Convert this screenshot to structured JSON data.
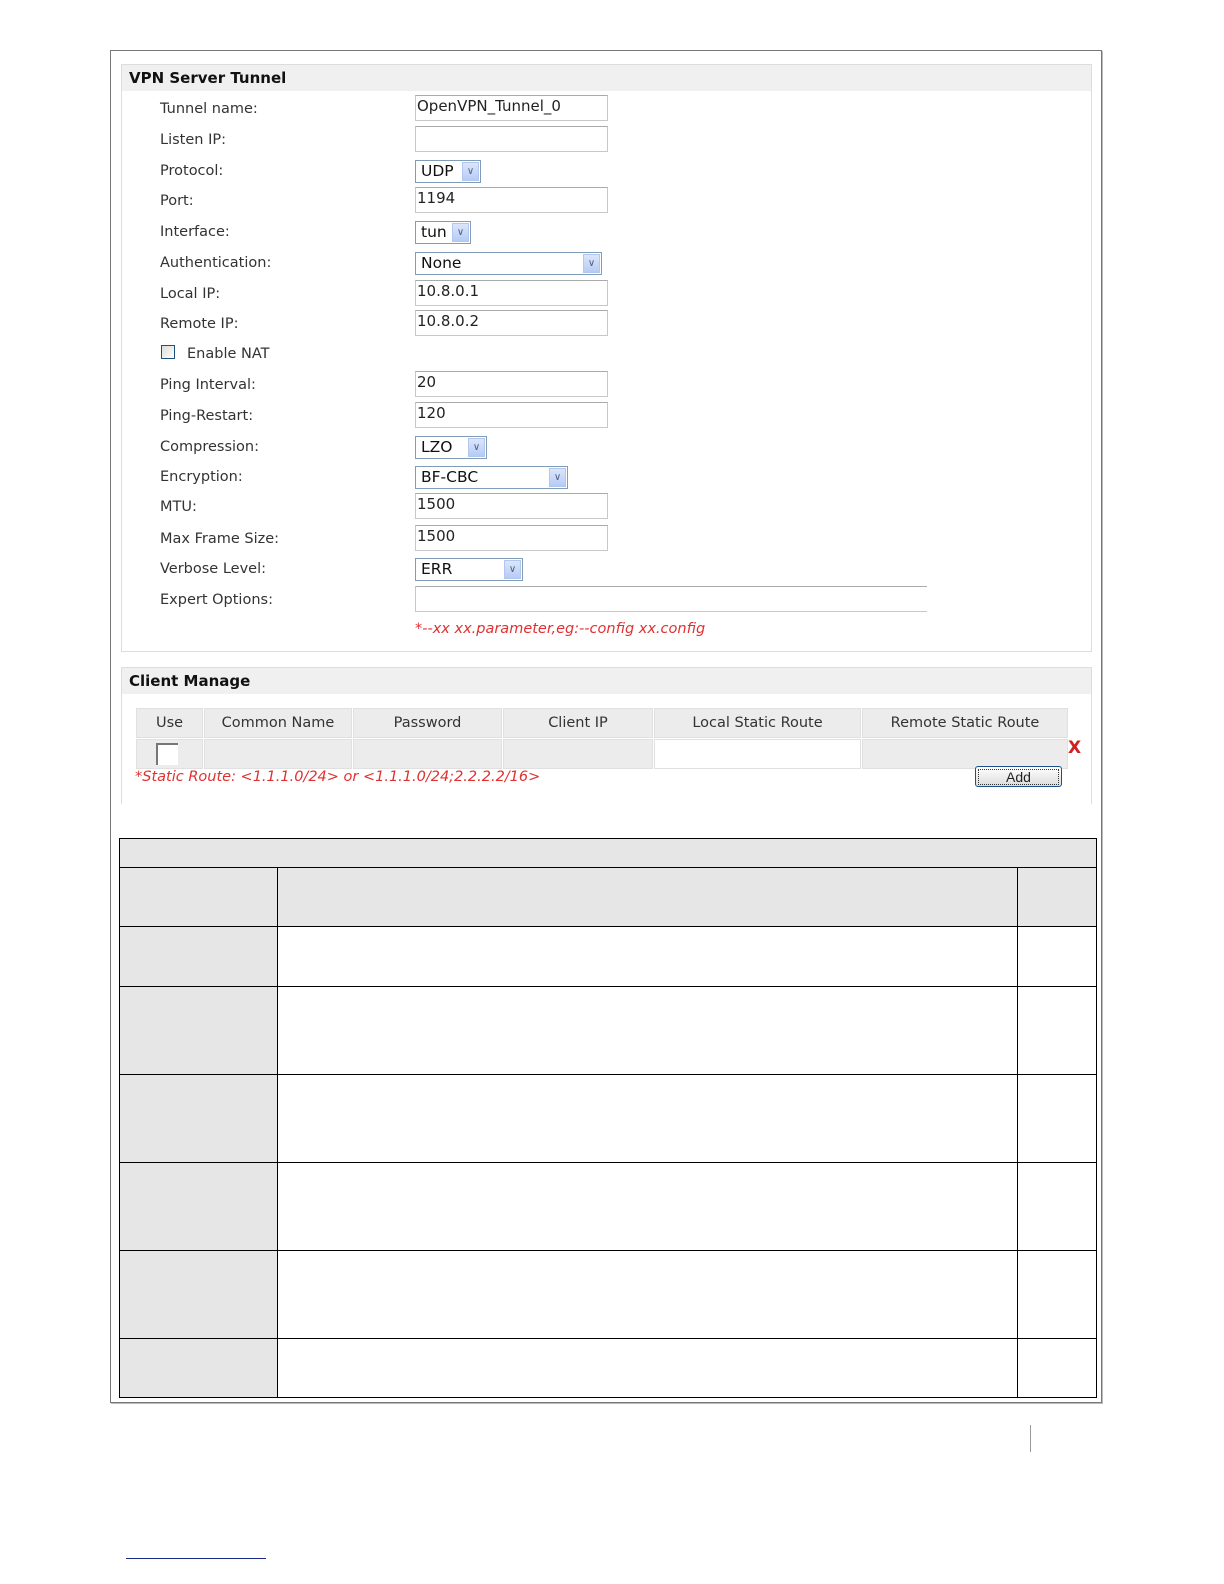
{
  "vpn_server_tunnel": {
    "title": "VPN Server Tunnel",
    "fields": [
      {
        "label": "Tunnel name:",
        "type": "text",
        "value": "OpenVPN_Tunnel_0"
      },
      {
        "label": "Listen IP:",
        "type": "text",
        "value": ""
      },
      {
        "label": "Protocol:",
        "type": "select",
        "value": "UDP"
      },
      {
        "label": "Port:",
        "type": "text",
        "value": "1194"
      },
      {
        "label": "Interface:",
        "type": "select",
        "value": "tun"
      },
      {
        "label": "Authentication:",
        "type": "select",
        "value": "None"
      },
      {
        "label": "Local IP:",
        "type": "text",
        "value": "10.8.0.1"
      },
      {
        "label": "Remote IP:",
        "type": "text",
        "value": "10.8.0.2"
      },
      {
        "label": "Enable NAT",
        "type": "checkbox",
        "checked": false
      },
      {
        "label": "Ping Interval:",
        "type": "text",
        "value": "20"
      },
      {
        "label": "Ping-Restart:",
        "type": "text",
        "value": "120"
      },
      {
        "label": "Compression:",
        "type": "select",
        "value": "LZO"
      },
      {
        "label": "Encryption:",
        "type": "select",
        "value": "BF-CBC"
      },
      {
        "label": "MTU:",
        "type": "text",
        "value": "1500"
      },
      {
        "label": "Max Frame Size:",
        "type": "text",
        "value": "1500"
      },
      {
        "label": "Verbose Level:",
        "type": "select",
        "value": "ERR"
      },
      {
        "label": "Expert Options:",
        "type": "text",
        "value": ""
      }
    ],
    "expert_hint": "*--xx xx.parameter,eg:--config xx.config"
  },
  "client_manage": {
    "title": "Client Manage",
    "columns": [
      "Use",
      "Common Name",
      "Password",
      "Client IP",
      "Local Static Route",
      "Remote Static Route"
    ],
    "delete_label": "X",
    "route_hint": "*Static Route: <1.1.1.0/24> or <1.1.1.0/24;2.2.2.2/16>",
    "add_label": "Add"
  },
  "colors": {
    "hint": "#e03030",
    "header_bg": "#f0f0f0",
    "table_gray": "#e6e6e6"
  }
}
